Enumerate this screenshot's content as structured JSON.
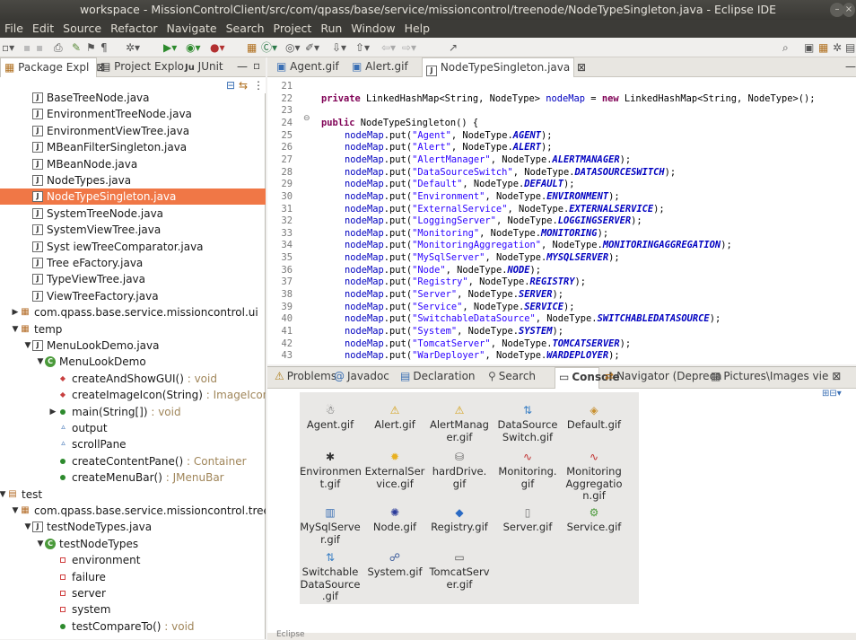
{
  "window": {
    "title": "workspace - MissionControlClient/src/com/qpass/base/service/missioncontrol/treenode/NodeTypeSingleton.java - Eclipse IDE"
  },
  "menu": [
    "File",
    "Edit",
    "Source",
    "Refactor",
    "Navigate",
    "Search",
    "Project",
    "Run",
    "Window",
    "Help"
  ],
  "left_tabs": [
    "Package Expl",
    "Project Explo",
    "JUnit"
  ],
  "tree": [
    {
      "label": "BaseTreeNode.java",
      "indent": 40,
      "icon": "java-file"
    },
    {
      "label": "EnvironmentTreeNode.java",
      "indent": 40,
      "icon": "java-file"
    },
    {
      "label": "EnvironmentViewTree.java",
      "indent": 40,
      "icon": "java-file"
    },
    {
      "label": "MBeanFilterSingleton.java",
      "indent": 40,
      "icon": "java-file"
    },
    {
      "label": "MBeanNode.java",
      "indent": 40,
      "icon": "java-file"
    },
    {
      "label": "NodeTypes.java",
      "indent": 40,
      "icon": "java-file"
    },
    {
      "label": "NodeTypeSingleton.java",
      "indent": 40,
      "icon": "java-file",
      "selected": true
    },
    {
      "label": "SystemTreeNode.java",
      "indent": 40,
      "icon": "java-file"
    },
    {
      "label": "SystemViewTree.java",
      "indent": 40,
      "icon": "java-file"
    },
    {
      "label": "Syst    iewTreeComparator.java",
      "indent": 40,
      "icon": "java-file"
    },
    {
      "label": "Tree    eFactory.java",
      "indent": 40,
      "icon": "java-file"
    },
    {
      "label": "TypeViewTree.java",
      "indent": 40,
      "icon": "java-file"
    },
    {
      "label": "ViewTreeFactory.java",
      "indent": 40,
      "icon": "java-file"
    },
    {
      "label": "com.qpass.base.service.missioncontrol.ui",
      "indent": 26,
      "icon": "package",
      "arrow": "right"
    },
    {
      "label": "temp",
      "indent": 26,
      "icon": "package",
      "arrow": "down"
    },
    {
      "label": "MenuLookDemo.java",
      "indent": 40,
      "icon": "java-file",
      "arrow": "down"
    },
    {
      "label": "MenuLookDemo",
      "indent": 54,
      "icon": "class",
      "arrow": "down"
    },
    {
      "label": "createAndShowGUI()",
      "ret": " : void",
      "indent": 68,
      "icon": "method-static"
    },
    {
      "label": "createImageIcon(String)",
      "ret": " : ImageIcon",
      "indent": 68,
      "icon": "method-static"
    },
    {
      "label": "main(String[])",
      "ret": " : void",
      "indent": 68,
      "icon": "method",
      "arrow": "right"
    },
    {
      "label": "output",
      "indent": 68,
      "icon": "field"
    },
    {
      "label": "scrollPane",
      "indent": 68,
      "icon": "field"
    },
    {
      "label": "createContentPane()",
      "ret": " : Container",
      "indent": 68,
      "icon": "method"
    },
    {
      "label": "createMenuBar()",
      "ret": " : JMenuBar",
      "indent": 68,
      "icon": "method"
    },
    {
      "label": "test",
      "indent": 12,
      "icon": "folder",
      "arrow": "down"
    },
    {
      "label": "com.qpass.base.service.missioncontrol.treen",
      "indent": 26,
      "icon": "package",
      "arrow": "down"
    },
    {
      "label": "testNodeTypes.java",
      "indent": 40,
      "icon": "java-file",
      "arrow": "down"
    },
    {
      "label": "testNodeTypes",
      "indent": 54,
      "icon": "class-test",
      "arrow": "down"
    },
    {
      "label": "environment",
      "indent": 68,
      "icon": "field-private"
    },
    {
      "label": "failure",
      "indent": 68,
      "icon": "field-private"
    },
    {
      "label": "server",
      "indent": 68,
      "icon": "field-private"
    },
    {
      "label": "system",
      "indent": 68,
      "icon": "field-private"
    },
    {
      "label": "testCompareTo()",
      "ret": " : void",
      "indent": 68,
      "icon": "method"
    }
  ],
  "editor_tabs": [
    "Agent.gif",
    "Alert.gif",
    "NodeTypeSingleton.java"
  ],
  "code_lines": [
    {
      "n": "21",
      "t": []
    },
    {
      "n": "22",
      "t": [
        [
          "kw",
          "private "
        ],
        [
          "",
          "LinkedHashMap<String, NodeType> "
        ],
        [
          "fld",
          "nodeMap"
        ],
        [
          "",
          " = "
        ],
        [
          "kw",
          "new "
        ],
        [
          "",
          "LinkedHashMap<String, NodeType>();"
        ]
      ]
    },
    {
      "n": "23",
      "t": []
    },
    {
      "n": "24",
      "t": [
        [
          "kw",
          "public "
        ],
        [
          "",
          "NodeTypeSingleton() {"
        ]
      ]
    },
    {
      "n": "25",
      "k": "Agent",
      "c": "AGENT"
    },
    {
      "n": "26",
      "k": "Alert",
      "c": "ALERT"
    },
    {
      "n": "27",
      "k": "AlertManager",
      "c": "ALERTMANAGER"
    },
    {
      "n": "28",
      "k": "DataSourceSwitch",
      "c": "DATASOURCESWITCH"
    },
    {
      "n": "29",
      "k": "Default",
      "c": "DEFAULT"
    },
    {
      "n": "30",
      "k": "Environment",
      "c": "ENVIRONMENT"
    },
    {
      "n": "31",
      "k": "ExternalService",
      "c": "EXTERNALSERVICE"
    },
    {
      "n": "32",
      "k": "LoggingServer",
      "c": "LOGGINGSERVER"
    },
    {
      "n": "33",
      "k": "Monitoring",
      "c": "MONITORING"
    },
    {
      "n": "34",
      "k": "MonitoringAggregation",
      "c": "MONITORINGAGGREGATION"
    },
    {
      "n": "35",
      "k": "MySqlServer",
      "c": "MYSQLSERVER"
    },
    {
      "n": "36",
      "k": "Node",
      "c": "NODE"
    },
    {
      "n": "37",
      "k": "Registry",
      "c": "REGISTRY"
    },
    {
      "n": "38",
      "k": "Server",
      "c": "SERVER"
    },
    {
      "n": "39",
      "k": "Service",
      "c": "SERVICE"
    },
    {
      "n": "40",
      "k": "SwitchableDataSource",
      "c": "SWITCHABLEDATASOURCE"
    },
    {
      "n": "41",
      "k": "System",
      "c": "SYSTEM"
    },
    {
      "n": "42",
      "k": "TomcatServer",
      "c": "TOMCATSERVER"
    },
    {
      "n": "43",
      "k": "WarDeployer",
      "c": "WARDEPLOYER"
    }
  ],
  "bottom_tabs": [
    "Problems",
    "Javadoc",
    "Declaration",
    "Search",
    "Console",
    "Navigator (Depreca",
    "Pictures\\Images vie"
  ],
  "images": [
    {
      "name": "Agent.gif",
      "icon": "agent",
      "glyph": "☃"
    },
    {
      "name": "Alert.gif",
      "icon": "alert",
      "glyph": "⚠"
    },
    {
      "name": "AlertManag er.gif",
      "icon": "alert",
      "glyph": "⚠"
    },
    {
      "name": "DataSource Switch.gif",
      "icon": "switch",
      "glyph": "⇅"
    },
    {
      "name": "Default.gif",
      "icon": "default",
      "glyph": "◈"
    },
    {
      "name": "Environmen t.gif",
      "icon": "environment",
      "glyph": "✱"
    },
    {
      "name": "ExternalSer vice.gif",
      "icon": "sun",
      "glyph": "✹"
    },
    {
      "name": "hardDrive. gif",
      "icon": "drive",
      "glyph": "⛁"
    },
    {
      "name": "Monitoring. gif",
      "icon": "monitor",
      "glyph": "∿"
    },
    {
      "name": "Monitoring Aggregatio n.gif",
      "icon": "monitor",
      "glyph": "∿"
    },
    {
      "name": "MySqlServe r.gif",
      "icon": "database",
      "glyph": "▥"
    },
    {
      "name": "Node.gif",
      "icon": "node",
      "glyph": "✺"
    },
    {
      "name": "Registry.gif",
      "icon": "cube",
      "glyph": "◆"
    },
    {
      "name": "Server.gif",
      "icon": "server",
      "glyph": "▯"
    },
    {
      "name": "Service.gif",
      "icon": "gear",
      "glyph": "⚙"
    },
    {
      "name": "Switchable DataSource .gif",
      "icon": "switch",
      "glyph": "⇅"
    },
    {
      "name": "System.gif",
      "icon": "network",
      "glyph": "☍"
    },
    {
      "name": "TomcatServ er.gif",
      "icon": "computer",
      "glyph": "▭"
    }
  ],
  "footer_text": "Eclipse"
}
